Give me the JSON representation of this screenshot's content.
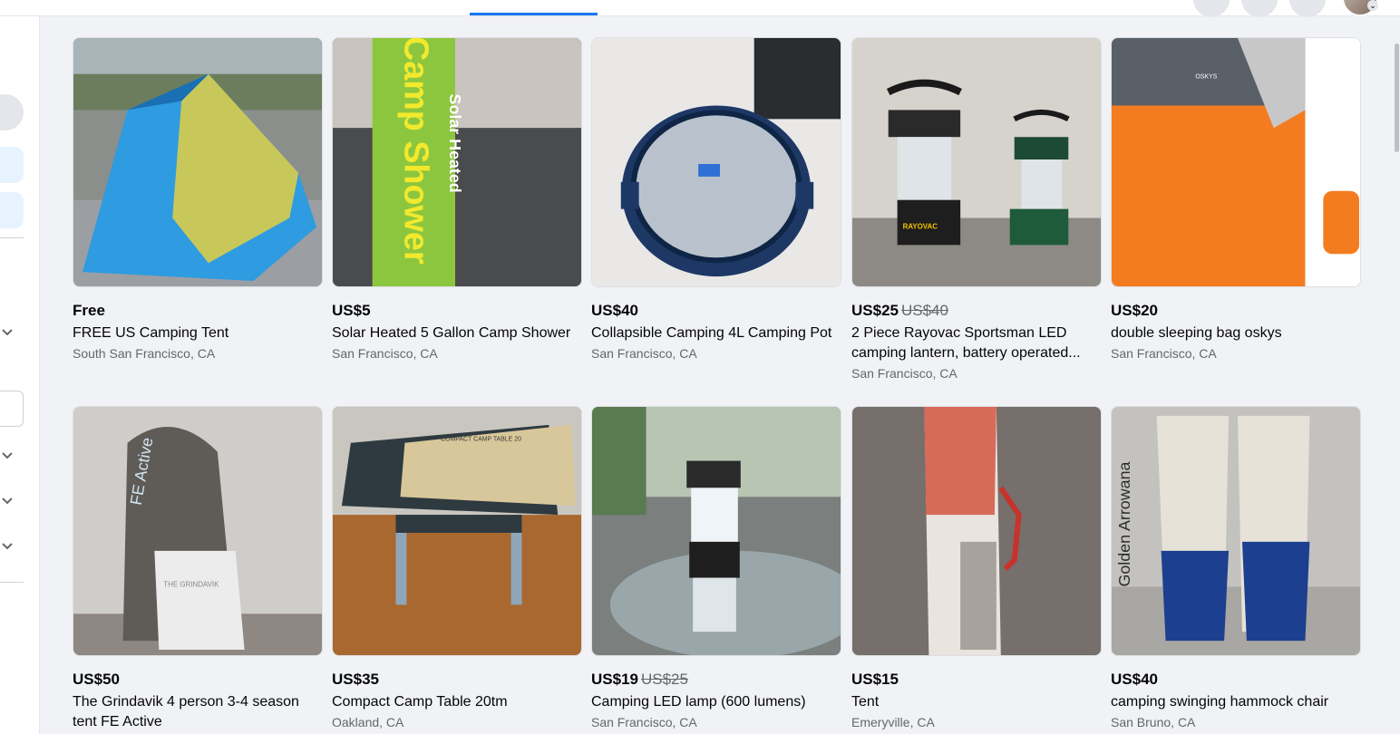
{
  "header": {
    "nav_icons": [
      "messenger-icon",
      "notifications-icon",
      "menu-icon"
    ],
    "avatar_chevron": "⌄"
  },
  "sidebar": {
    "chevrons": [
      "⌄",
      "⌄",
      "⌄",
      "⌄"
    ]
  },
  "listings": [
    {
      "price": "Free",
      "old_price": "",
      "title": "FREE US Camping Tent",
      "location": "South San Francisco, CA"
    },
    {
      "price": "US$5",
      "old_price": "",
      "title": "Solar Heated 5 Gallon Camp Shower",
      "location": "San Francisco, CA"
    },
    {
      "price": "US$40",
      "old_price": "",
      "title": "Collapsible Camping 4L Camping Pot",
      "location": "San Francisco, CA"
    },
    {
      "price": "US$25",
      "old_price": "US$40",
      "title": "2 Piece Rayovac Sportsman LED camping lantern, battery operated...",
      "location": "San Francisco, CA"
    },
    {
      "price": "US$20",
      "old_price": "",
      "title": "double sleeping bag oskys",
      "location": "San Francisco, CA"
    },
    {
      "price": "US$50",
      "old_price": "",
      "title": "The Grindavik 4 person 3-4 season tent FE Active",
      "location": ""
    },
    {
      "price": "US$35",
      "old_price": "",
      "title": "Compact Camp Table 20tm",
      "location": "Oakland, CA"
    },
    {
      "price": "US$19",
      "old_price": "US$25",
      "title": "Camping LED lamp (600 lumens)",
      "location": "San Francisco, CA"
    },
    {
      "price": "US$15",
      "old_price": "",
      "title": "Tent",
      "location": "Emeryville, CA"
    },
    {
      "price": "US$40",
      "old_price": "",
      "title": "camping swinging hammock chair",
      "location": "San Bruno, CA"
    }
  ],
  "image_text": {
    "shower_line1": "Solar Heated",
    "shower_line2": "Camp Shower",
    "lantern_brand": "RAYOVAC",
    "sleeping_bag_brand": "OSKYS",
    "tent_bag_brand": "FE Active",
    "tent_tag": "THE GRINDAVIK",
    "table_box": "COMPACT CAMP TABLE 20",
    "hammock_brand": "Golden Arrowana"
  },
  "colors": {
    "accent": "#1877f2",
    "background": "#f0f2f5",
    "secondary_text": "#65676b"
  }
}
